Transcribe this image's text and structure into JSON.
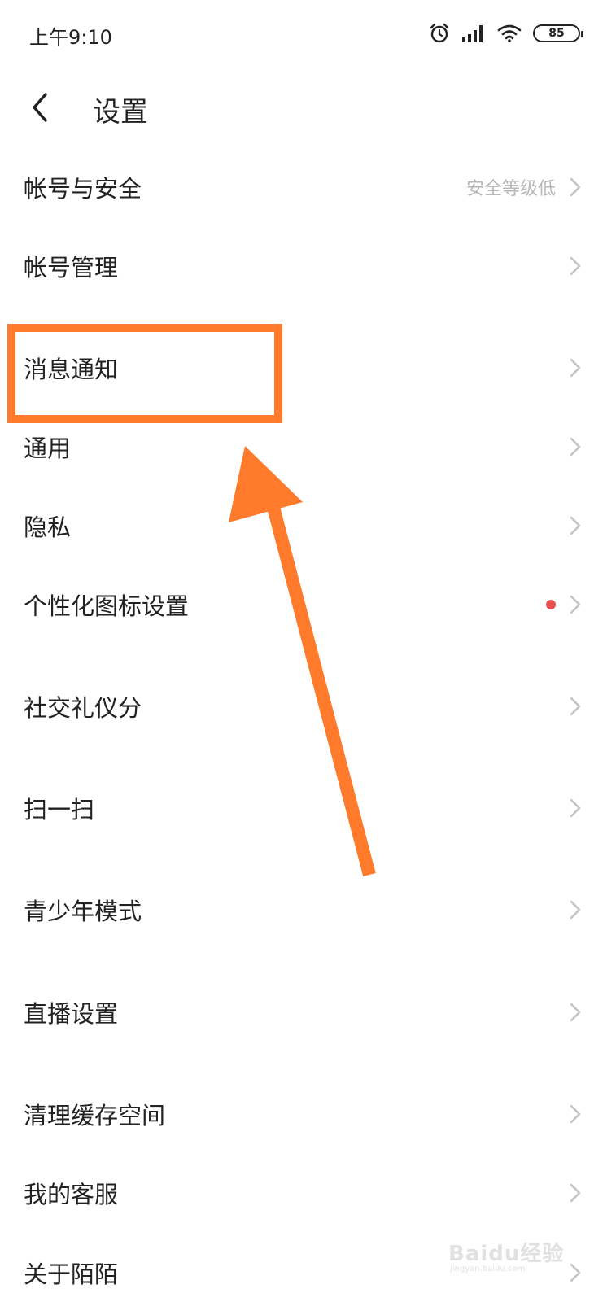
{
  "status_bar": {
    "time": "上午9:10",
    "battery": "85",
    "icons": [
      "alarm-icon",
      "signal-icon",
      "wifi-icon",
      "battery-icon"
    ]
  },
  "nav": {
    "title": "设置",
    "back_icon": "chevron-left-icon"
  },
  "settings": {
    "items": [
      {
        "label": "帐号与安全",
        "sub": "安全等级低"
      },
      {
        "label": "帐号管理"
      },
      {
        "label": "消息通知",
        "highlighted": true
      },
      {
        "label": "通用"
      },
      {
        "label": "隐私"
      },
      {
        "label": "个性化图标设置",
        "badge": "red-dot"
      },
      {
        "label": "社交礼仪分"
      },
      {
        "label": "扫一扫"
      },
      {
        "label": "青少年模式"
      },
      {
        "label": "直播设置"
      },
      {
        "label": "清理缓存空间"
      },
      {
        "label": "我的客服"
      },
      {
        "label": "关于陌陌"
      }
    ]
  },
  "annotation": {
    "color": "#ff7a2b",
    "shape": "rectangle-and-arrow"
  },
  "watermark": {
    "text": "Baidu经验",
    "sub": "jingyan.baidu.com"
  },
  "colors": {
    "text": "#222222",
    "subtext": "#b8b8b8",
    "chevron": "#c4c4c4",
    "badge": "#e94f4f",
    "annotation": "#ff7a2b"
  }
}
